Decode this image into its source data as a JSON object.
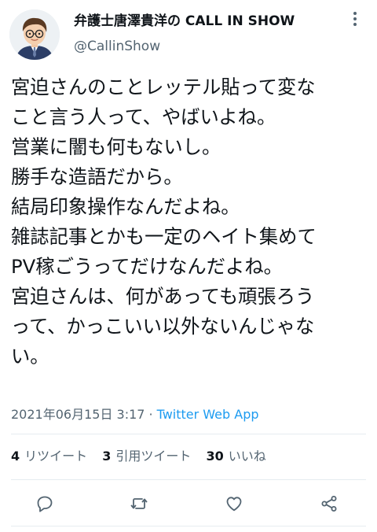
{
  "header": {
    "display_name": "弁護士唐澤貴洋の CALL IN SHOW",
    "handle": "@CallinShow",
    "avatar_icon": "person-avatar-icon",
    "more_icon": "more-vertical-icon"
  },
  "tweet": {
    "lines": [
      "宮迫さんのことレッテル貼って変な",
      "こと言う人って、やばいよね。",
      "営業に闇も何もないし。",
      "勝手な造語だから。",
      "結局印象操作なんだよね。",
      "雑誌記事とかも一定のヘイト集めて",
      "PV稼ごうってだけなんだよね。",
      "宮迫さんは、何があっても頑張ろう",
      "って、かっこいい以外ないんじゃな",
      "い。"
    ]
  },
  "meta": {
    "timestamp": "2021年06月15日 3:17",
    "separator": "·",
    "source": "Twitter Web App"
  },
  "stats": {
    "retweets_count": "4",
    "retweets_label": "リツイート",
    "quotes_count": "3",
    "quotes_label": "引用ツイート",
    "likes_count": "30",
    "likes_label": "いいね"
  },
  "actions": {
    "reply_icon": "reply-icon",
    "retweet_icon": "retweet-icon",
    "like_icon": "heart-icon",
    "share_icon": "share-icon"
  },
  "colors": {
    "text": "#0f1419",
    "secondary": "#536471",
    "link": "#1d9bf0",
    "divider": "#e6ecf0"
  }
}
